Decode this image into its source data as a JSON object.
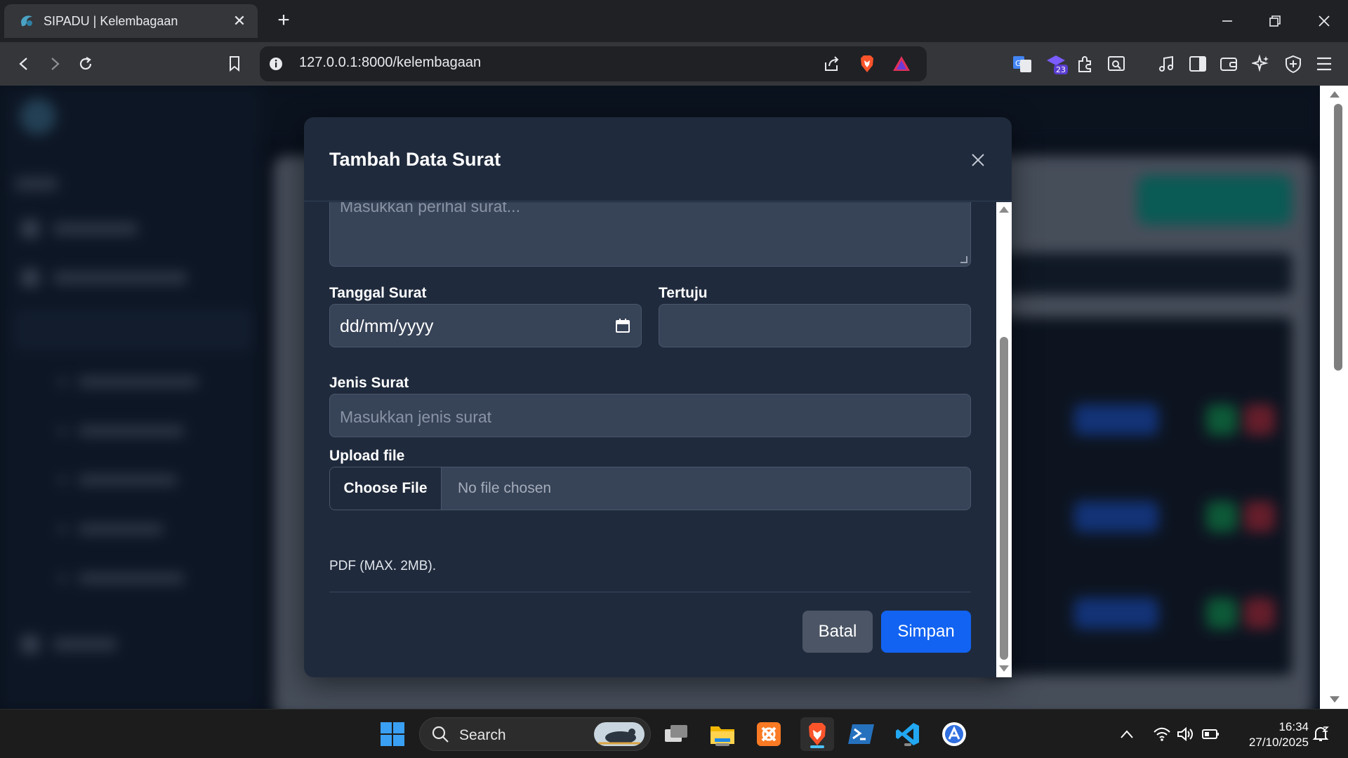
{
  "browser": {
    "tab_title": "SIPADU | Kelembagaan",
    "url": "127.0.0.1:8000/kelembagaan",
    "extension_badge": "23"
  },
  "modal": {
    "title": "Tambah Data Surat",
    "perihal_placeholder": "Masukkan perihal surat...",
    "tanggal_label": "Tanggal Surat",
    "tanggal_value": "dd/mm/yyyy",
    "tertuju_label": "Tertuju",
    "tertuju_value": "",
    "jenis_label": "Jenis Surat",
    "jenis_placeholder": "Masukkan jenis surat",
    "upload_label": "Upload file",
    "choose_file_label": "Choose File",
    "no_file_text": "No file chosen",
    "file_hint": "PDF (MAX. 2MB).",
    "cancel_label": "Batal",
    "save_label": "Simpan"
  },
  "taskbar": {
    "search_label": "Search",
    "time": "16:34",
    "date": "27/10/2025"
  },
  "colors": {
    "modal_bg": "#1f2a3c",
    "input_bg": "#374357",
    "primary": "#1263f1",
    "secondary": "#4b5565"
  }
}
